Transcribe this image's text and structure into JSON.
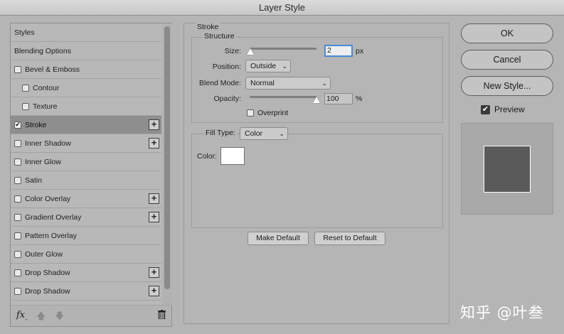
{
  "window": {
    "title": "Layer Style"
  },
  "styles_list": {
    "items": [
      {
        "label": "Styles",
        "checkbox": false,
        "indent": false,
        "checked": false,
        "selected": false,
        "plus": false
      },
      {
        "label": "Blending Options",
        "checkbox": false,
        "indent": false,
        "checked": false,
        "selected": false,
        "plus": false
      },
      {
        "label": "Bevel & Emboss",
        "checkbox": true,
        "indent": false,
        "checked": false,
        "selected": false,
        "plus": false
      },
      {
        "label": "Contour",
        "checkbox": true,
        "indent": true,
        "checked": false,
        "selected": false,
        "plus": false
      },
      {
        "label": "Texture",
        "checkbox": true,
        "indent": true,
        "checked": false,
        "selected": false,
        "plus": false
      },
      {
        "label": "Stroke",
        "checkbox": true,
        "indent": false,
        "checked": true,
        "selected": true,
        "plus": true
      },
      {
        "label": "Inner Shadow",
        "checkbox": true,
        "indent": false,
        "checked": false,
        "selected": false,
        "plus": true
      },
      {
        "label": "Inner Glow",
        "checkbox": true,
        "indent": false,
        "checked": false,
        "selected": false,
        "plus": false
      },
      {
        "label": "Satin",
        "checkbox": true,
        "indent": false,
        "checked": false,
        "selected": false,
        "plus": false
      },
      {
        "label": "Color Overlay",
        "checkbox": true,
        "indent": false,
        "checked": false,
        "selected": false,
        "plus": true
      },
      {
        "label": "Gradient Overlay",
        "checkbox": true,
        "indent": false,
        "checked": false,
        "selected": false,
        "plus": true
      },
      {
        "label": "Pattern Overlay",
        "checkbox": true,
        "indent": false,
        "checked": false,
        "selected": false,
        "plus": false
      },
      {
        "label": "Outer Glow",
        "checkbox": true,
        "indent": false,
        "checked": false,
        "selected": false,
        "plus": false
      },
      {
        "label": "Drop Shadow",
        "checkbox": true,
        "indent": false,
        "checked": false,
        "selected": false,
        "plus": true
      },
      {
        "label": "Drop Shadow",
        "checkbox": true,
        "indent": false,
        "checked": false,
        "selected": false,
        "plus": true
      }
    ],
    "footer": {
      "fx_label": "fx",
      "fx_suffix": "."
    }
  },
  "stroke": {
    "section_title": "Stroke",
    "structure_title": "Structure",
    "size": {
      "label": "Size:",
      "value": "2",
      "unit": "px",
      "slider_fraction": 0.01
    },
    "position": {
      "label": "Position:",
      "selected": "Outside"
    },
    "blend_mode": {
      "label": "Blend Mode:",
      "selected": "Normal"
    },
    "opacity": {
      "label": "Opacity:",
      "value": "100",
      "unit": "%",
      "slider_fraction": 1.0
    },
    "overprint": {
      "label": "Overprint",
      "checked": false
    },
    "fill_type": {
      "label": "Fill Type:",
      "selected": "Color"
    },
    "color": {
      "label": "Color:",
      "value": "#ffffff"
    },
    "make_default_label": "Make Default",
    "reset_default_label": "Reset to Default"
  },
  "actions": {
    "ok_label": "OK",
    "cancel_label": "Cancel",
    "new_style_label": "New Style...",
    "preview_label": "Preview",
    "preview_checked": true
  },
  "watermark": "知乎 @叶叁"
}
